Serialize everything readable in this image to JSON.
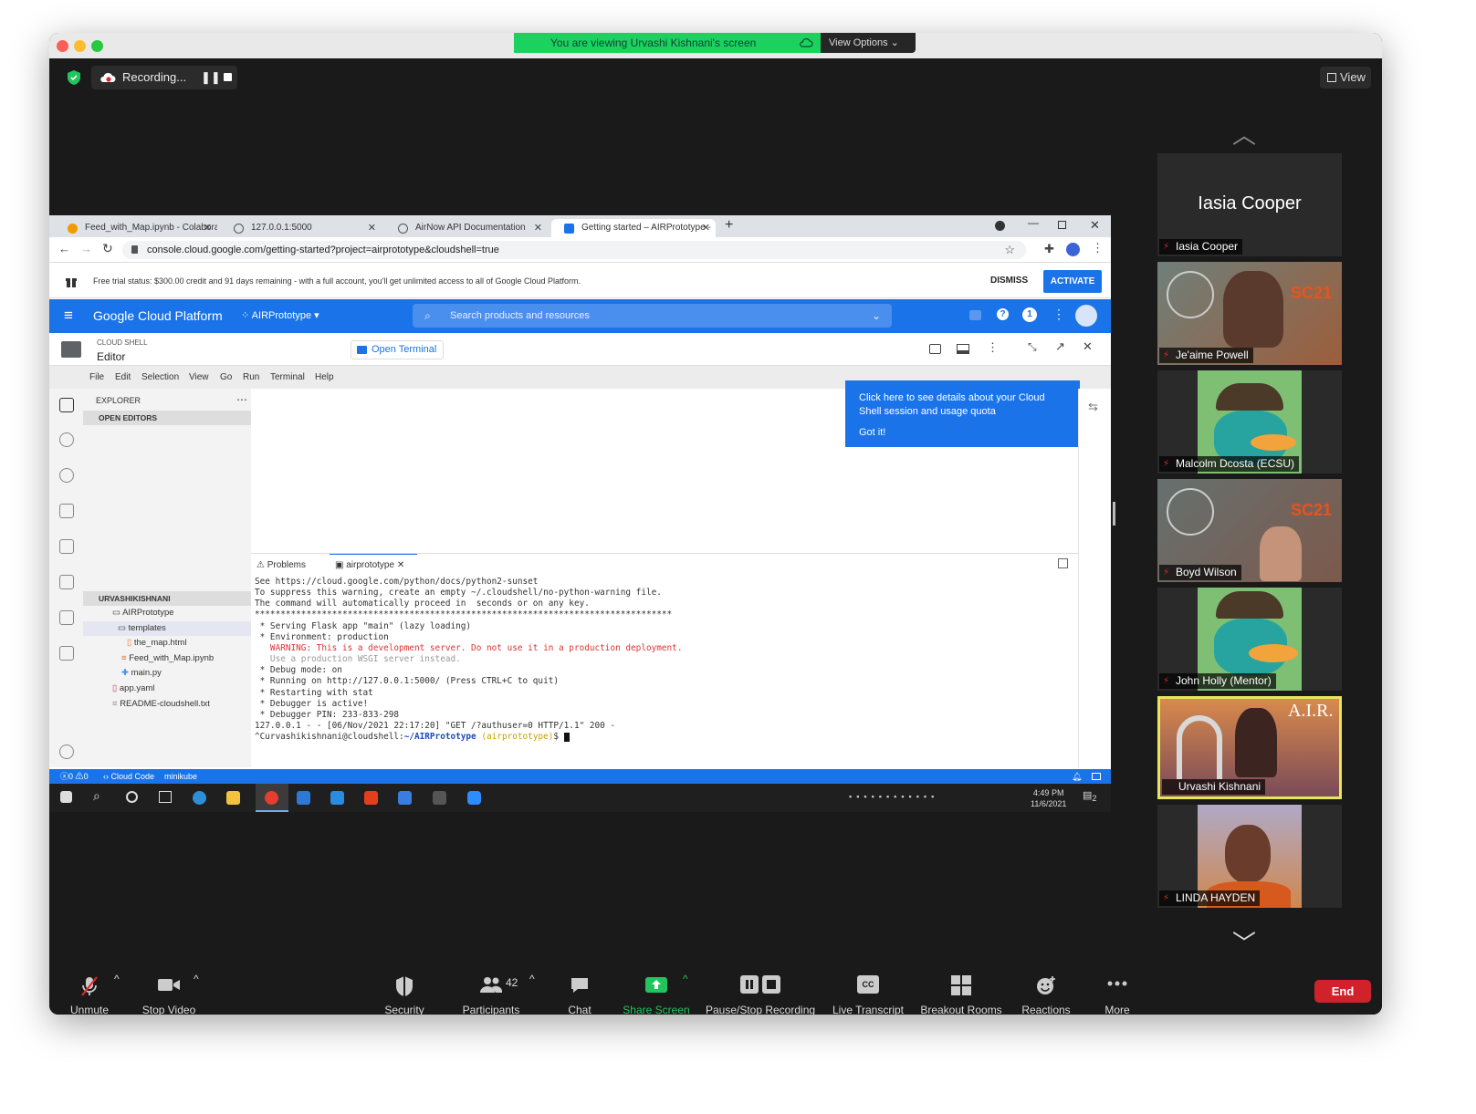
{
  "zoom": {
    "banner": "You are viewing Urvashi Kishnani's screen",
    "view_options": "View Options",
    "recording": "Recording...",
    "view": "View",
    "controls": [
      {
        "label": "Unmute",
        "icon": "mic-muted-icon"
      },
      {
        "label": "Stop Video",
        "icon": "video-camera-icon"
      },
      {
        "label": "Security",
        "icon": "shield-icon"
      },
      {
        "label": "Participants",
        "icon": "participants-icon",
        "count": "42"
      },
      {
        "label": "Chat",
        "icon": "chat-icon"
      },
      {
        "label": "Share Screen",
        "icon": "share-screen-icon"
      },
      {
        "label": "Pause/Stop Recording",
        "icon": "pause-stop-icon"
      },
      {
        "label": "Live Transcript",
        "icon": "cc-icon",
        "cc": "CC"
      },
      {
        "label": "Breakout Rooms",
        "icon": "breakout-rooms-icon"
      },
      {
        "label": "Reactions",
        "icon": "reactions-icon"
      },
      {
        "label": "More",
        "icon": "more-icon"
      }
    ],
    "end": "End",
    "participants": [
      {
        "name": "Iasia Cooper"
      },
      {
        "name": "Je'aime Powell"
      },
      {
        "name": "Malcolm Dcosta (ECSU)"
      },
      {
        "name": "Boyd Wilson"
      },
      {
        "name": "John Holly (Mentor)"
      },
      {
        "name": "Urvashi Kishnani"
      },
      {
        "name": "LINDA HAYDEN"
      }
    ]
  },
  "browser": {
    "tabs": [
      {
        "label": "Feed_with_Map.ipynb - Colabora"
      },
      {
        "label": "127.0.0.1:5000"
      },
      {
        "label": "AirNow API Documentation"
      },
      {
        "label": "Getting started – AIRPrototype -"
      }
    ],
    "url": "console.cloud.google.com/getting-started?project=airprototype&cloudshell=true"
  },
  "gcp": {
    "trial": "Free trial status: $300.00 credit and 91 days remaining - with a full account, you'll get unlimited access to all of Google Cloud Platform.",
    "dismiss": "DISMISS",
    "activate": "ACTIVATE",
    "title": "Google Cloud Platform",
    "project": "AIRPrototype",
    "search_placeholder": "Search products and resources",
    "notif_count": "1"
  },
  "cloudshell": {
    "small": "CLOUD SHELL",
    "title": "Editor",
    "open_terminal": "Open Terminal",
    "menu": [
      "File",
      "Edit",
      "Selection",
      "View",
      "Go",
      "Run",
      "Terminal",
      "Help"
    ],
    "tooltip": "Click here to see details about your Cloud Shell session and usage quota",
    "got_it": "Got it!"
  },
  "explorer": {
    "title": "EXPLORER",
    "open_editors": "OPEN EDITORS",
    "root": "URVASHIKISHNANI",
    "tree": [
      {
        "label": "AIRPrototype"
      },
      {
        "label": "templates"
      },
      {
        "label": "the_map.html"
      },
      {
        "label": "Feed_with_Map.ipynb"
      },
      {
        "label": "main.py"
      },
      {
        "label": "app.yaml"
      },
      {
        "label": "README-cloudshell.txt"
      }
    ]
  },
  "panel": {
    "tab_problems": "Problems",
    "tab_terminal": "airprototype",
    "lines": [
      "See https://cloud.google.com/python/docs/python2-sunset",
      "",
      "To suppress this warning, create an empty ~/.cloudshell/no-python-warning file.",
      "The command will automatically proceed in  seconds or on any key.",
      "*********************************************************************************",
      " * Serving Flask app \"main\" (lazy loading)",
      " * Environment: production",
      "   WARNING: This is a development server. Do not use it in a production deployment.",
      "   Use a production WSGI server instead.",
      " * Debug mode: on",
      " * Running on http://127.0.0.1:5000/ (Press CTRL+C to quit)",
      " * Restarting with stat",
      " * Debugger is active!",
      " * Debugger PIN: 233-833-298",
      "127.0.0.1 - - [06/Nov/2021 22:17:20] \"GET /?authuser=0 HTTP/1.1\" 200 -"
    ],
    "prompt_user": "^Curvashikishnani@cloudshell:",
    "prompt_path": "~/AIRPrototype",
    "prompt_env": "(airprototype)",
    "prompt_end": "$"
  },
  "status": {
    "errors": "0",
    "warnings": "0",
    "cloud_code": "Cloud Code",
    "minikube": "minikube"
  },
  "taskbar": {
    "time": "4:49 PM",
    "date": "11/6/2021",
    "notifications": "2"
  }
}
